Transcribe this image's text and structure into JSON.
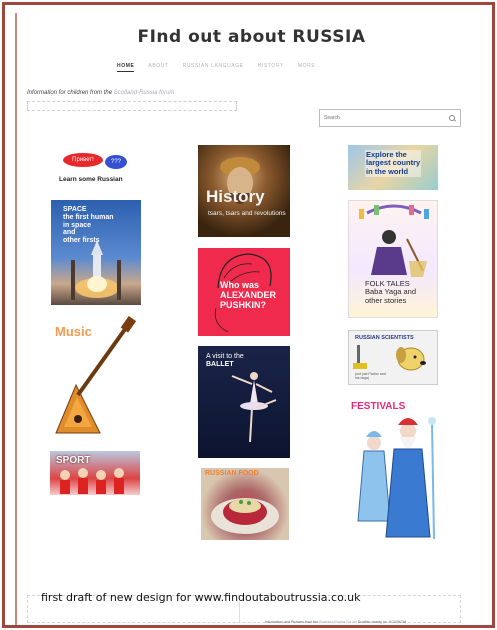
{
  "header": {
    "title": "FInd out about RUSSIA",
    "nav": [
      "HOME",
      "ABOUT",
      "RUSSIAN LANGUAGE",
      "HISTORY",
      "MORE..."
    ]
  },
  "tagline": {
    "text": "Information for children from the ",
    "link": "Scotland-Russia forum"
  },
  "search": {
    "placeholder": "Search"
  },
  "tiles": {
    "learn": {
      "bubble1": "Привет!",
      "bubble2": "???",
      "label": "Learn some Russian"
    },
    "space": {
      "l1": "SPACE",
      "l2": "the first human",
      "l3": "in space",
      "l4": "and",
      "l5": "other firsts"
    },
    "music": {
      "label": "Music"
    },
    "sport": {
      "label": "SPORT"
    },
    "history": {
      "big": "History",
      "small": "tsars, tsars and revolutions"
    },
    "pushkin": {
      "l1": "Who was",
      "l2": "ALEXANDER",
      "l3": "PUSHKIN?"
    },
    "ballet": {
      "l1": "A visit to the",
      "l2": "BALLET"
    },
    "food": {
      "label": "RUSSIAN FOOD"
    },
    "explore": {
      "l1": "Explore the",
      "l2": "largest country",
      "l3": "in the world"
    },
    "folk": {
      "l1": "FOLK TALES",
      "l2": "Baba Yaga and",
      "l3": "other stories"
    },
    "scientists": {
      "head": "RUSSIAN SCIENTISTS",
      "sub1": "(not just Pavlov and",
      "sub2": "his dogs)"
    },
    "festivals": {
      "label": "FESTIVALS"
    }
  },
  "footer": {
    "caption": "first draft of new design for www.findoutaboutrussia.co.uk",
    "credit_prefix": "Information and Pictures from the ",
    "credit_link": "Scotland-Russia Forum",
    "credit_suffix": " Scottish charity no. SC039238"
  },
  "colors": {
    "frame": "#a0463c",
    "pushkin_bg": "#f02a4c",
    "festivals_text": "#e8287a",
    "music_text": "#f39c50"
  }
}
